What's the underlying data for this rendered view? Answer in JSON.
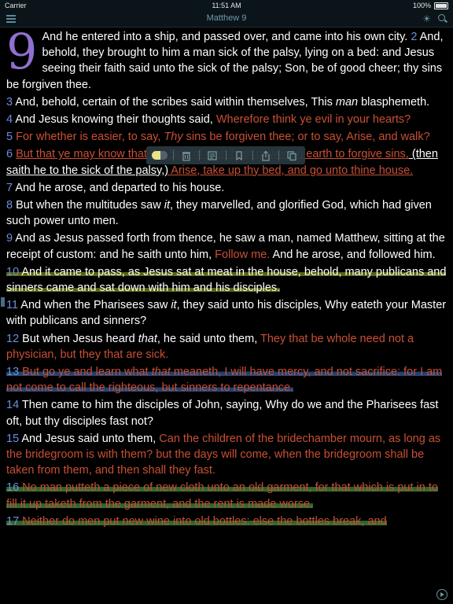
{
  "status_bar": {
    "carrier": "Carrier",
    "time": "11:51 AM",
    "battery": "100%"
  },
  "nav": {
    "title": "Matthew 9",
    "icons": [
      "menu-icon",
      "brightness-icon",
      "search-icon"
    ]
  },
  "toolbar": {
    "icons": [
      "highlight-toggle-icon",
      "trash-icon",
      "note-icon",
      "bookmark-icon",
      "share-icon",
      "copy-icon"
    ]
  },
  "chapter_number": "9",
  "colors": {
    "verse_number": "#6b8fdc",
    "words_of_christ": "#c94f35",
    "drop_cap": "#8f70cf",
    "highlight_yellow": "#6e7d19",
    "highlight_blue": "#284b7d",
    "highlight_green": "#3c7332"
  },
  "verses": {
    "v1": {
      "t": "And he entered into a ship, and passed over, and came into his own city."
    },
    "v2": {
      "n": "2",
      "t": "And, behold, they brought to him a man sick of the palsy, lying on a bed: and Jesus seeing their faith said unto the sick of the palsy; Son, be of good cheer; thy sins be forgiven thee."
    },
    "v3": {
      "n": "3",
      "a": "And, behold, certain of the scribes said within themselves, This ",
      "b": "man",
      "c": " blasphemeth."
    },
    "v4": {
      "n": "4",
      "a": "And Jesus knowing their thoughts said, ",
      "r": "Wherefore think ye evil in your hearts?"
    },
    "v5": {
      "n": "5",
      "r1": "For whether is easier, to say, ",
      "r2": "Thy",
      "r3": " sins be forgiven thee; or to say, Arise, and walk?"
    },
    "v6": {
      "n": "6",
      "r1": "But that ye may know that the Son of man hath power on earth to forgive sins,",
      "w": " (then saith he to the sick of the palsy,)",
      "r2": " Arise, take up thy bed, and go unto thine house."
    },
    "v7": {
      "n": "7",
      "t": "And he arose, and departed to his house."
    },
    "v8": {
      "n": "8",
      "a": "But when the multitudes saw ",
      "b": "it",
      "c": ", they marvelled, and glorified God, which had given such power unto men."
    },
    "v9": {
      "n": "9",
      "a": "And as Jesus passed forth from thence, he saw a man, named Matthew, sitting at the receipt of custom: and he saith unto him, ",
      "r": "Follow me.",
      "c": " And he arose, and followed him."
    },
    "v10": {
      "n": "10",
      "t": "And it came to pass, as Jesus sat at meat in the house, behold, many publicans and sinners came and sat down with him and his disciples."
    },
    "v11": {
      "n": "11",
      "a": "And when the Pharisees saw ",
      "b": "it",
      "c": ", they said unto his disciples, Why eateth your Master with publicans and sinners?"
    },
    "v12": {
      "n": "12",
      "a": "But when Jesus heard ",
      "b": "that",
      "c": ", he said unto them, ",
      "r": "They that be whole need not a physician, but they that are sick."
    },
    "v13": {
      "n": "13",
      "r1": "But go ye and learn what ",
      "r2": "that",
      "r3": " meaneth, I will have mercy, and not sacrifice: for I am not come to call the righteous, but sinners to repentance."
    },
    "v14": {
      "n": "14",
      "t": "Then came to him the disciples of John, saying, Why do we and the Pharisees fast oft, but thy disciples fast not?"
    },
    "v15": {
      "n": "15",
      "a": "And Jesus said unto them, ",
      "r": "Can the children of the bridechamber mourn, as long as the bridegroom is with them? but the days will come, when the bridegroom shall be taken from them, and then shall they fast."
    },
    "v16": {
      "n": "16",
      "r": "No man putteth a piece of new cloth unto an old garment, for that which is put in to fill it up taketh from the garment, and the rent is made worse."
    },
    "v17": {
      "n": "17",
      "r": "Neither do men put new wine into old bottles: else the bottles break, and"
    }
  }
}
